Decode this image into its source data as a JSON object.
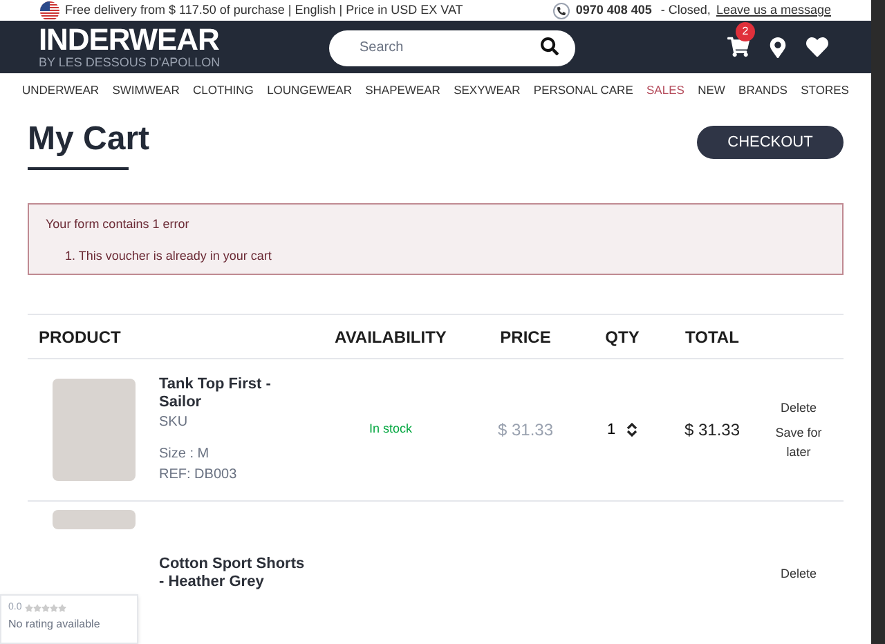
{
  "top_bar": {
    "promo": "Free delivery from $ 117.50 of purchase | English | Price in USD EX VAT",
    "phone": "0970 408 405",
    "status": " - Closed,",
    "link": "Leave us a message"
  },
  "header": {
    "logo": "INDERWEAR",
    "logo_sub": "BY LES DESSOUS D'APOLLON",
    "search": {
      "placeholder": "Search"
    },
    "cart_count": "2"
  },
  "nav": [
    {
      "label": "UNDERWEAR",
      "kind": "normal"
    },
    {
      "label": "SWIMWEAR",
      "kind": "normal"
    },
    {
      "label": "CLOTHING",
      "kind": "normal"
    },
    {
      "label": "LOUNGEWEAR",
      "kind": "normal"
    },
    {
      "label": "SHAPEWEAR",
      "kind": "normal"
    },
    {
      "label": "SEXYWEAR",
      "kind": "normal"
    },
    {
      "label": "PERSONAL CARE",
      "kind": "normal"
    },
    {
      "label": "SALES",
      "kind": "sale"
    },
    {
      "label": "NEW",
      "kind": "normal"
    },
    {
      "label": "BRANDS",
      "kind": "normal"
    },
    {
      "label": "STORES",
      "kind": "normal"
    }
  ],
  "page_title": "My Cart",
  "checkout": "CHECKOUT",
  "error": {
    "title": "Your form contains 1 error",
    "items": [
      "1. This voucher is already in your cart"
    ]
  },
  "table": {
    "columns": [
      "PRODUCT",
      "AVAILABILITY",
      "PRICE",
      "QTY",
      "TOTAL"
    ],
    "rows": [
      {
        "name": "Tank Top First - Sailor",
        "sku": "SKU",
        "size": "Size : M",
        "ref": "REF: DB003",
        "availability": "In stock",
        "price": "$ 31.33",
        "qty": "1",
        "total": "$ 31.33",
        "actions": [
          "Delete",
          "Save for later"
        ]
      },
      {
        "name": "Cotton Sport Shorts - Heather Grey",
        "actions": [
          "Delete"
        ]
      }
    ]
  },
  "rating_widget": {
    "score": "0.0",
    "text": "No rating available"
  }
}
